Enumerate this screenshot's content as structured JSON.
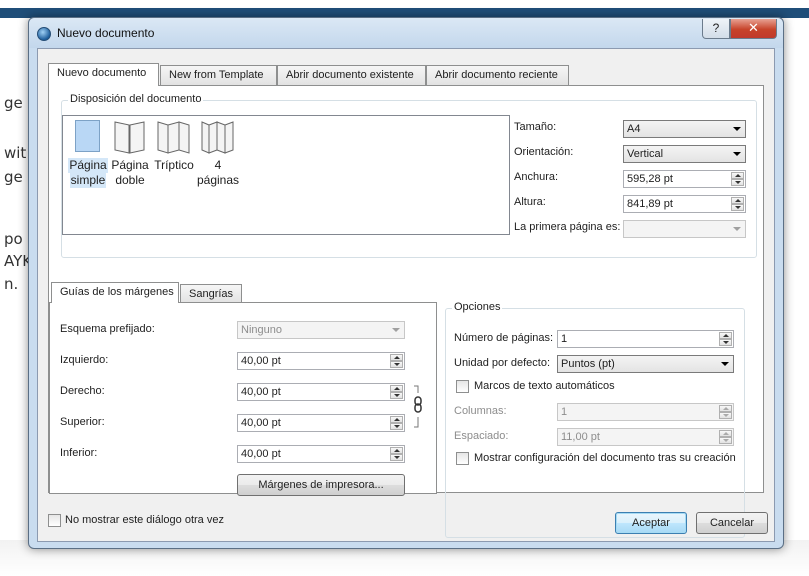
{
  "background": {
    "snippets": [
      "ge",
      "wit",
      "ge",
      "po",
      "AYK",
      "n."
    ]
  },
  "window": {
    "title": "Nuevo documento",
    "help_label": "?",
    "close_label": "✕"
  },
  "tabs": [
    {
      "label": "Nuevo documento"
    },
    {
      "label": "New from Template"
    },
    {
      "label": "Abrir documento existente"
    },
    {
      "label": "Abrir documento reciente"
    }
  ],
  "layout_group": {
    "title": "Disposición del documento",
    "options": [
      {
        "line1": "Página",
        "line2": "simple"
      },
      {
        "line1": "Página",
        "line2": "doble"
      },
      {
        "line1": "Tríptico",
        "line2": ""
      },
      {
        "line1": "4",
        "line2": "páginas"
      }
    ],
    "size_label": "Tamaño:",
    "size_value": "A4",
    "orientation_label": "Orientación:",
    "orientation_value": "Vertical",
    "width_label": "Anchura:",
    "width_value": "595,28 pt",
    "height_label": "Altura:",
    "height_value": "841,89 pt",
    "first_page_label": "La primera página es:",
    "first_page_value": ""
  },
  "margins": {
    "tab_label": "Guías de los márgenes",
    "tab2_label": "Sangrías",
    "preset_label": "Esquema prefijado:",
    "preset_value": "Ninguno",
    "left_label": "Izquierdo:",
    "left_value": "40,00 pt",
    "right_label": "Derecho:",
    "right_value": "40,00 pt",
    "top_label": "Superior:",
    "top_value": "40,00 pt",
    "bottom_label": "Inferior:",
    "bottom_value": "40,00 pt",
    "printer_button": "Márgenes de impresora..."
  },
  "options": {
    "title": "Opciones",
    "pages_label": "Número de páginas:",
    "pages_value": "1",
    "unit_label": "Unidad por defecto:",
    "unit_value": "Puntos (pt)",
    "auto_frames_label": "Marcos de texto automáticos",
    "columns_label": "Columnas:",
    "columns_value": "1",
    "spacing_label": "Espaciado:",
    "spacing_value": "11,00 pt",
    "show_settings_label": "Mostrar configuración del documento tras su creación"
  },
  "footer": {
    "dont_show_label": "No mostrar este diálogo otra vez",
    "accept_label": "Aceptar",
    "cancel_label": "Cancelar"
  }
}
